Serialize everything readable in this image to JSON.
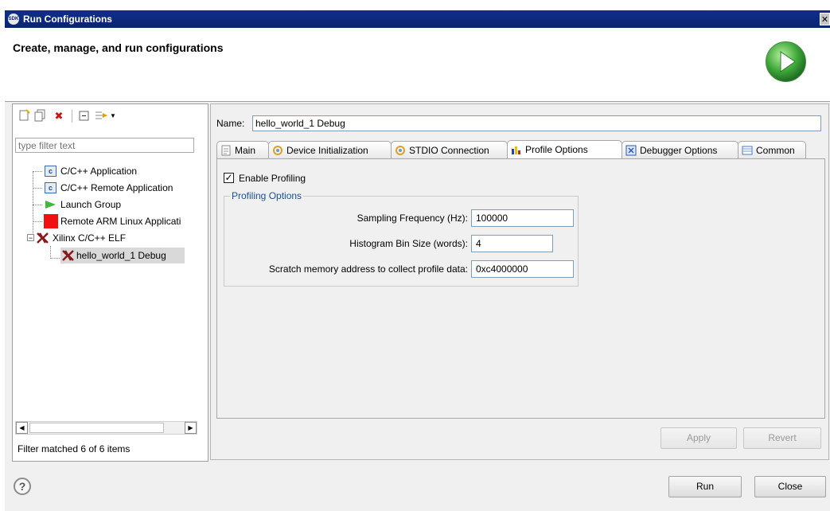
{
  "window": {
    "title": "Run Configurations",
    "app_icon_text": "SDK"
  },
  "header": {
    "title": "Create, manage, and run configurations"
  },
  "left_panel": {
    "filter_placeholder": "type filter text",
    "tree": [
      {
        "label": "C/C++ Application",
        "icon": "c-app-icon"
      },
      {
        "label": "C/C++ Remote Application",
        "icon": "c-app-icon"
      },
      {
        "label": "Launch Group",
        "icon": "launch-group-icon"
      },
      {
        "label": "Remote ARM Linux Applicati",
        "icon": "red-square-icon"
      },
      {
        "label": "Xilinx C/C++ ELF",
        "icon": "xilinx-icon",
        "expanded": true
      },
      {
        "label": "hello_world_1 Debug",
        "icon": "xilinx-icon",
        "selected": true
      }
    ],
    "filter_status": "Filter matched 6 of 6 items"
  },
  "right_panel": {
    "name_label": "Name:",
    "name_value": "hello_world_1 Debug",
    "tabs": [
      {
        "label": "Main"
      },
      {
        "label": "Device Initialization"
      },
      {
        "label": "STDIO Connection"
      },
      {
        "label": "Profile Options",
        "active": true
      },
      {
        "label": "Debugger Options"
      },
      {
        "label": "Common"
      }
    ],
    "enable_profiling_label": "Enable Profiling",
    "enable_profiling_checked": true,
    "group_title": "Profiling Options",
    "fields": [
      {
        "label": "Sampling Frequency (Hz):",
        "value": "100000"
      },
      {
        "label": "Histogram Bin Size (words):",
        "value": "4"
      },
      {
        "label": "Scratch memory address to collect profile data:",
        "value": "0xc4000000"
      }
    ],
    "apply_label": "Apply",
    "revert_label": "Revert"
  },
  "footer": {
    "help_label": "?",
    "run_label": "Run",
    "close_label": "Close"
  },
  "colors": {
    "titlebar": "#0a2470",
    "group_title": "#1c4fa0",
    "selection": "#d9d9d9"
  }
}
